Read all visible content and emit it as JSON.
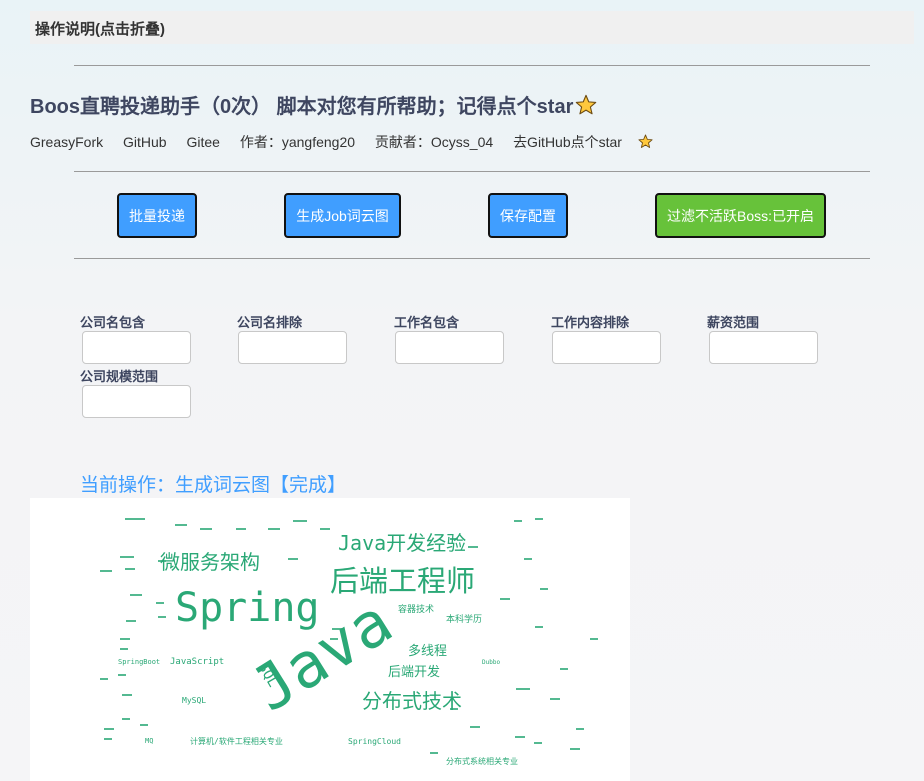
{
  "collapse": {
    "label": "操作说明(点击折叠)"
  },
  "header": {
    "title": "Boos直聘投递助手（0次） 脚本对您有所帮助；记得点个star"
  },
  "links": {
    "greasyfork": "GreasyFork",
    "github": "GitHub",
    "gitee": "Gitee",
    "author": "作者：yangfeng20",
    "contributor": "贡献者：Ocyss_04",
    "star_github": "去GitHub点个star"
  },
  "buttons": {
    "batch_deliver": "批量投递",
    "gen_wordcloud": "生成Job词云图",
    "save_config": "保存配置",
    "filter_inactive": "过滤不活跃Boss:已开启"
  },
  "filters": {
    "company_include": {
      "label": "公司名包含",
      "value": ""
    },
    "company_exclude": {
      "label": "公司名排除",
      "value": ""
    },
    "job_include": {
      "label": "工作名包含",
      "value": ""
    },
    "job_content_exclude": {
      "label": "工作内容排除",
      "value": ""
    },
    "salary_range": {
      "label": "薪资范围",
      "value": ""
    },
    "company_scale": {
      "label": "公司规模范围",
      "value": ""
    }
  },
  "status": {
    "text": "当前操作：生成词云图【完成】"
  },
  "wordcloud": {
    "color": "#2aa876",
    "words": {
      "java": "Java",
      "spring": "Spring",
      "backend_engineer": "后端工程师",
      "java_dev_exp": "Java开发经验",
      "microservices": "微服务架构",
      "distributed": "分布式技术",
      "multithreading": "多线程",
      "backend_dev": "后端开发",
      "javascript": "JavaScript",
      "springboot": "SpringBoot",
      "springcloud": "SpringCloud",
      "computer_major": "计算机/软件工程相关专业",
      "container_tech": "容器技术",
      "bachelor": "本科学历",
      "cs_related": "分布式系统相关专业",
      "sql": "SQL",
      "dubbo": "Dubbo",
      "mq": "MQ",
      "mysql": "MySQL"
    }
  }
}
